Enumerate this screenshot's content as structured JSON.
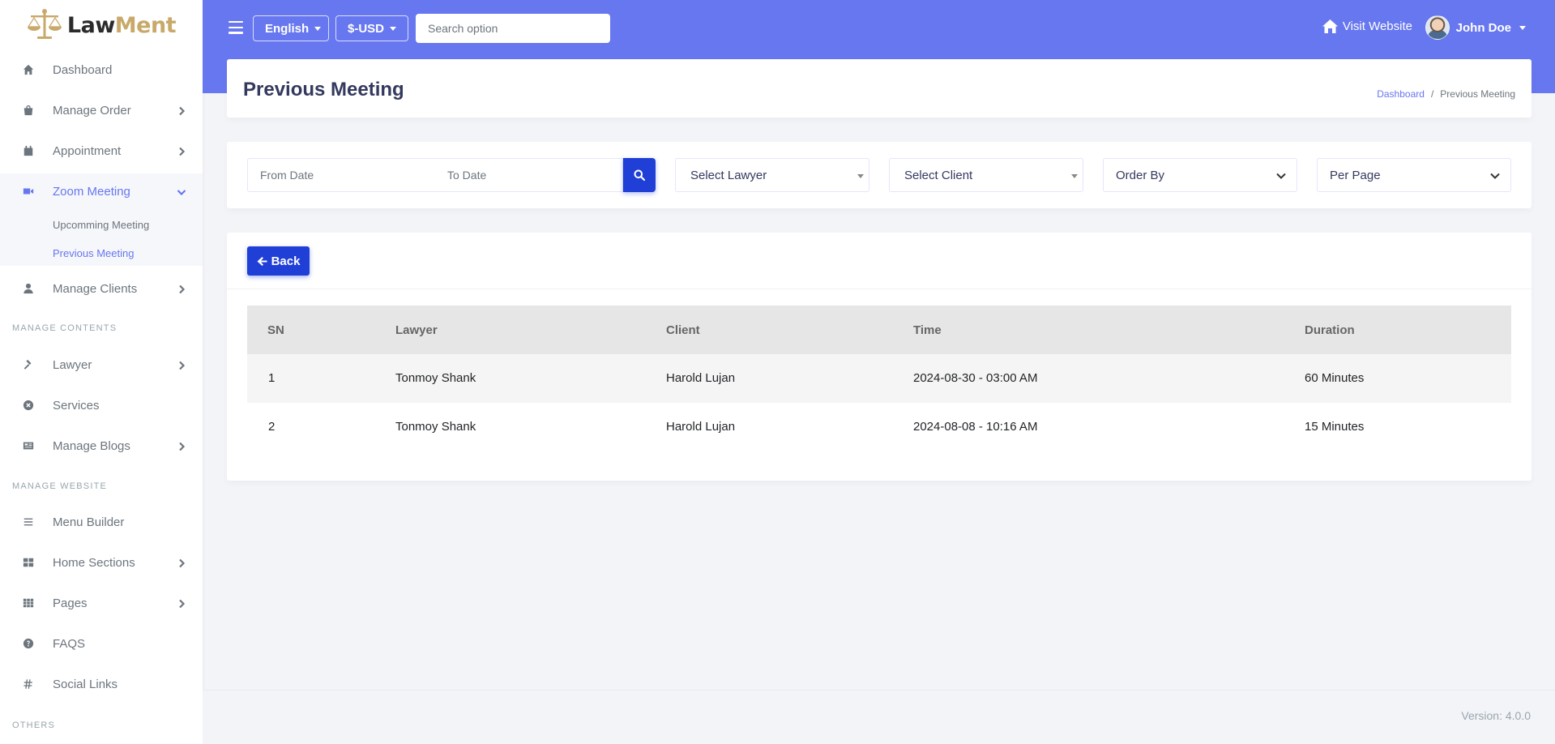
{
  "brand": {
    "name_part1": "Law",
    "name_part2": "Ment"
  },
  "sidebar": {
    "items": [
      {
        "label": "Dashboard",
        "icon": "fire-icon"
      },
      {
        "label": "Manage Order",
        "icon": "shopping-bag-icon"
      },
      {
        "label": "Appointment",
        "icon": "calendar-icon"
      },
      {
        "label": "Zoom Meeting",
        "icon": "video-icon"
      },
      {
        "label": "Manage Clients",
        "icon": "user-icon"
      },
      {
        "label": "Lawyer",
        "icon": "gavel-icon"
      },
      {
        "label": "Services",
        "icon": "times-circle-icon"
      },
      {
        "label": "Manage Blogs",
        "icon": "newspaper-icon"
      },
      {
        "label": "Menu Builder",
        "icon": "bars-icon"
      },
      {
        "label": "Home Sections",
        "icon": "th-large-icon"
      },
      {
        "label": "Pages",
        "icon": "th-icon"
      },
      {
        "label": "FAQS",
        "icon": "question-circle-icon"
      },
      {
        "label": "Social Links",
        "icon": "hashtag-icon"
      }
    ],
    "submenu": [
      {
        "label": "Upcomming Meeting"
      },
      {
        "label": "Previous Meeting"
      }
    ],
    "sections": {
      "manage_contents": "MANAGE CONTENTS",
      "manage_website": "MANAGE WEBSITE",
      "others": "OTHERS"
    }
  },
  "topbar": {
    "language": "English",
    "currency": "$-USD",
    "search_placeholder": "Search option",
    "visit_website": "Visit Website",
    "user_name": "John Doe"
  },
  "header": {
    "title": "Previous Meeting",
    "breadcrumb": {
      "home": "Dashboard",
      "separator": "/",
      "current": "Previous Meeting"
    }
  },
  "filters": {
    "from_date_placeholder": "From Date",
    "to_date_placeholder": "To Date",
    "select_lawyer": "Select Lawyer",
    "select_client": "Select Client",
    "order_by": "Order By",
    "per_page": "Per Page"
  },
  "back_label": "Back",
  "table": {
    "columns": [
      "SN",
      "Lawyer",
      "Client",
      "Time",
      "Duration"
    ],
    "rows": [
      {
        "sn": "1",
        "lawyer": "Tonmoy Shank",
        "client": "Harold Lujan",
        "time": "2024-08-30 - 03:00 AM",
        "duration": "60 Minutes"
      },
      {
        "sn": "2",
        "lawyer": "Tonmoy Shank",
        "client": "Harold Lujan",
        "time": "2024-08-08 - 10:16 AM",
        "duration": "15 Minutes"
      }
    ]
  },
  "footer": {
    "version": "Version: 4.0.0"
  },
  "colors": {
    "primary": "#6777ef",
    "button": "#1f3fd6",
    "gold": "#c8a96a"
  }
}
